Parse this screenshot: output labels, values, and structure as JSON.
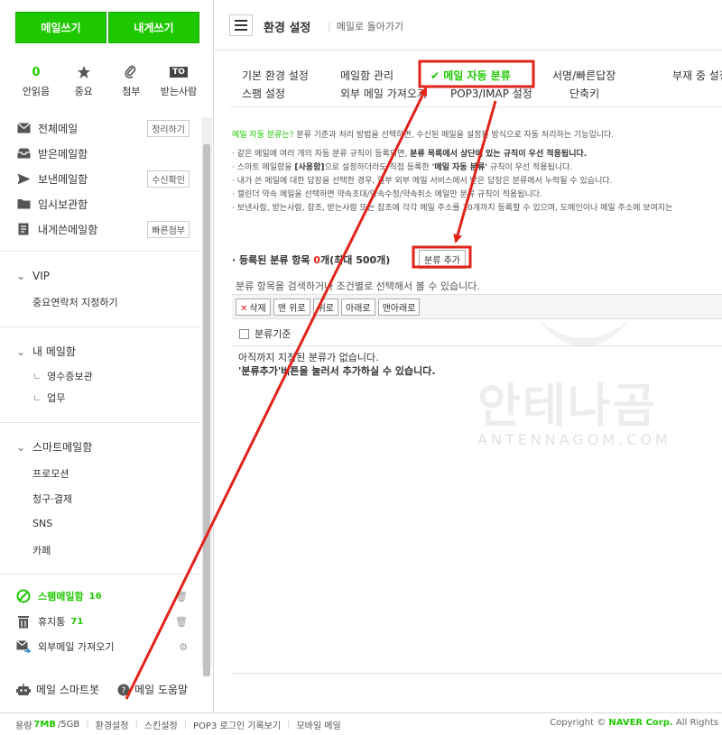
{
  "sidebar": {
    "write_mail": "메일쓰기",
    "write_self": "내게쓰기",
    "quick": [
      {
        "count": "0",
        "label": "안읽음",
        "icon": "envelope-count"
      },
      {
        "label": "중요",
        "icon": "star-icon"
      },
      {
        "label": "첨부",
        "icon": "paperclip-icon"
      },
      {
        "badge": "TO",
        "label": "받는사람",
        "icon": "to-badge"
      }
    ],
    "folders": [
      {
        "label": "전체메일",
        "button": "정리하기",
        "icon": "all-mail-icon"
      },
      {
        "label": "받은메일함",
        "icon": "inbox-icon"
      },
      {
        "label": "보낸메일함",
        "button": "수신확인",
        "icon": "send-icon"
      },
      {
        "label": "임시보관함",
        "icon": "folder-icon"
      },
      {
        "label": "내게쓴메일함",
        "button": "빠른첨부",
        "icon": "note-icon"
      }
    ],
    "vip": {
      "title": "VIP",
      "items": [
        "중요연락처 지정하기"
      ]
    },
    "my_mail": {
      "title": "내 메일함",
      "items": [
        "영수증보관",
        "업무"
      ]
    },
    "smart": {
      "title": "스마트메일함",
      "items": [
        "프로모션",
        "청구·결제",
        "SNS",
        "카페"
      ]
    },
    "spam": {
      "label": "스팸메일함",
      "count": "16"
    },
    "trash": {
      "label": "휴지통",
      "count": "71"
    },
    "external": {
      "label": "외부메일 가져오기"
    },
    "smartbot": "메일 스마트봇",
    "help": "메일 도움말"
  },
  "header": {
    "title": "환경 설정",
    "back": "메일로 돌아가기"
  },
  "tabs": {
    "row1": [
      "기본 환경 설정",
      "메일함 관리",
      "메일 자동 분류",
      "서명/빠른답장",
      "부재 중 설정"
    ],
    "row2": [
      "스팸 설정",
      "외부 메일 가져오기",
      "POP3/IMAP 설정",
      "단축키"
    ],
    "active": "메일 자동 분류"
  },
  "description": {
    "lead": "메일 자동 분류는?",
    "line0": " 분류 기준과 처리 방법을 선택하면, 수신된 메일을 설정된 방식으로 자동 처리하는 기능입니다.",
    "line1a": "· 같은 메일에 여러 개의 자동 분류 규칙이 등록되면, ",
    "line1b": "분류 목록에서 상단에 있는 규칙이 우선 적용됩니다.",
    "line2a": "· 스마트 메일함을 ",
    "line2b": "[사용함]",
    "line2c": "으로 설정하더라도 직접 등록한 ",
    "line2d": "'메일 자동 분류'",
    "line2e": " 규칙이 우선 적용됩니다.",
    "line3": "· 내가 쓴 메일에 대한 답장을 선택한 경우, 일부 외부 메일 서비스에서 받은 답장은 분류에서 누락될 수 있습니다.",
    "line4": "· 캘린더 약속 메일을 선택하면 약속초대/약속수정/약속취소 메일만 분류 규칙이 적용됩니다.",
    "line5": "· 보낸사람, 받는사람, 참조, 받는사람 또는 참조에 각각 메일 주소를 10개까지 등록할 수 있으며, 도메인이나 메일 주소에 보여지는"
  },
  "rules": {
    "title_prefix": "· 등록된 분류 항목 ",
    "count": "0",
    "title_suffix": "개(최대 500개)",
    "add_button": "분류 추가",
    "search_hint": "분류 항목을 검색하거나 조건별로 선택해서 볼 수 있습니다.",
    "toolbar": {
      "delete": "삭제",
      "top": "맨 위로",
      "up": "위로",
      "down": "아래로",
      "bottom": "맨아래로"
    },
    "column": "분류기준",
    "empty1": "아직까지 지정된 분류가 없습니다.",
    "empty2": "'분류추가'버튼을 눌러서 추가하실 수 있습니다."
  },
  "watermark": {
    "logo": "안테나곰",
    "sub": "ANTENNAGOM.COM"
  },
  "statusbar": {
    "usage_label": "용량",
    "usage_value": "7MB",
    "usage_total": "/5GB",
    "links": [
      "환경설정",
      "스킨설정",
      "POP3 로그인 기록보기",
      "모바일 메일"
    ],
    "copyright_prefix": "Copyright © ",
    "copyright_brand": "NAVER Corp.",
    "copyright_suffix": " All Rights"
  },
  "colors": {
    "accent": "#1ec800",
    "annotation": "#e2231a"
  }
}
